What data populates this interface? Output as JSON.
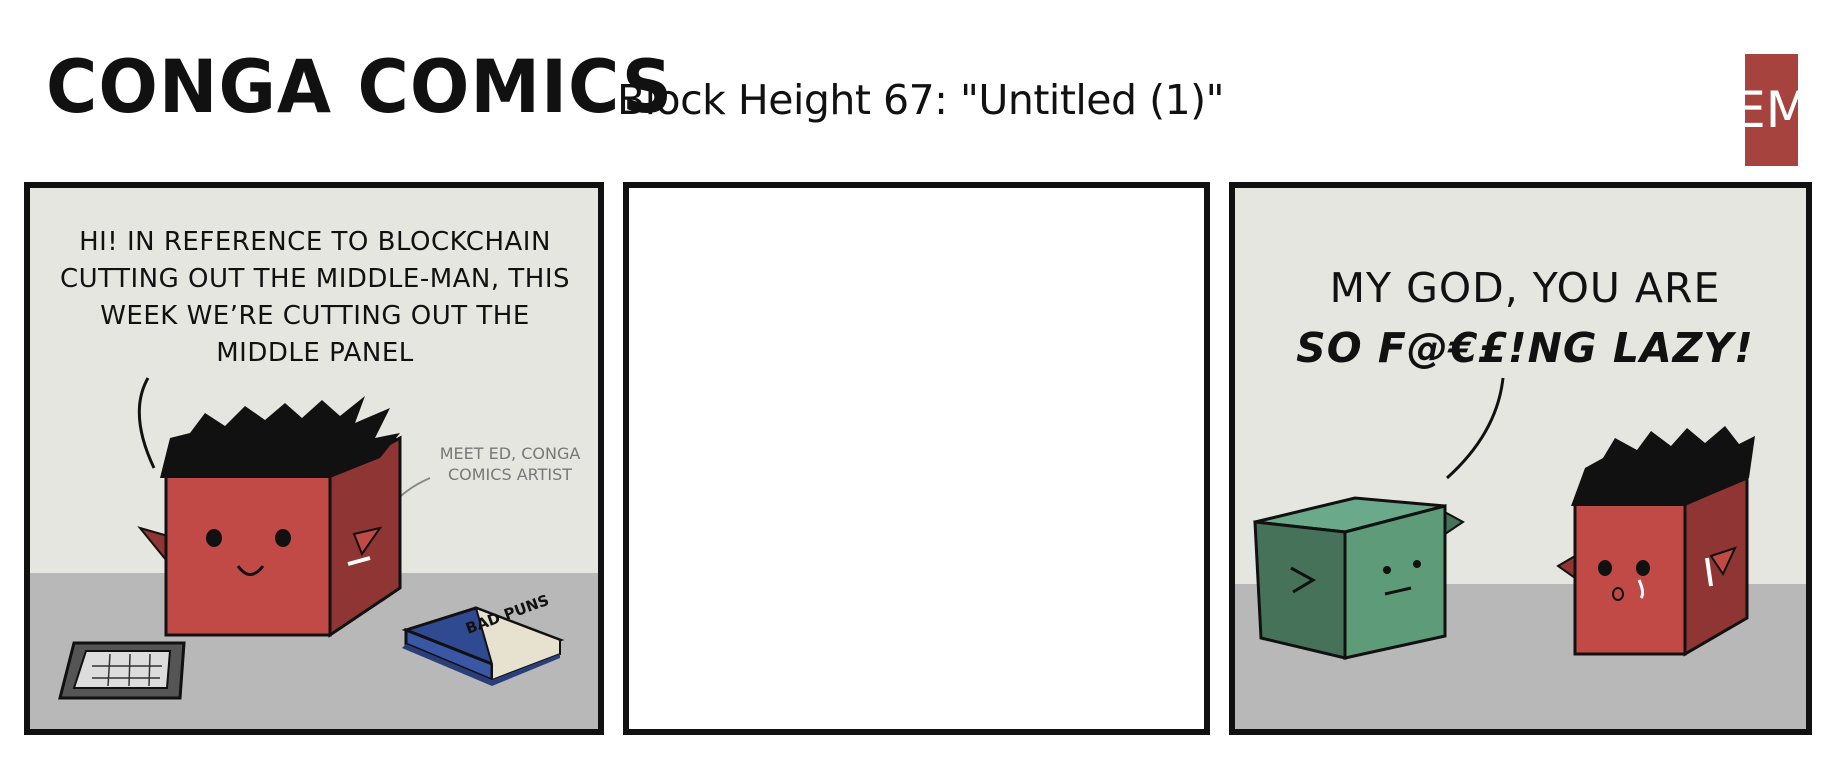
{
  "header": {
    "title": "CONGA COMICS",
    "subtitle": "Block Height 67: \"Untitled (1)\"",
    "logo_text": "EM"
  },
  "panels": [
    {
      "speech": "HI! IN REFERENCE TO BLOCKCHAIN CUTTING OUT THE MIDDLE-MAN, THIS WEEK WE’RE CUTTING OUT THE MIDDLE PANEL",
      "note": "MEET ED, CONGA COMICS ARTIST",
      "book_label": "BAD PUNS"
    },
    {},
    {
      "speech_line1": "MY GOD, YOU ARE",
      "speech_line2": "SO F@€£!NG LAZY!"
    }
  ],
  "colors": {
    "ed_red": "#c24a46",
    "ed_red_side": "#8f3533",
    "green_block": "#5e9b78",
    "green_block_side": "#467259",
    "book_blue": "#3a57a6",
    "floor": "#b8b8b8",
    "wall": "#e6e6e1",
    "logo": "#a7433f"
  }
}
